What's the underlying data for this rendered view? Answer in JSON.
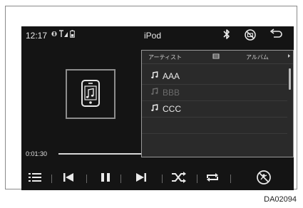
{
  "status_bar": {
    "time": "12:17",
    "title": "iPod",
    "icons": [
      "bluetooth-phone-icon",
      "signal-icon",
      "battery-icon",
      "bluetooth-icon",
      "no-media-icon",
      "back-icon"
    ]
  },
  "artwork": {
    "icon": "phone-music-icon"
  },
  "browse_popup": {
    "tabs": [
      "アーティスト",
      "アルバム"
    ],
    "tab_icons": [
      "list-icon",
      "chevron-right-icon"
    ],
    "items": [
      {
        "label": "AAA",
        "enabled": true
      },
      {
        "label": "BBB",
        "enabled": false
      },
      {
        "label": "CCC",
        "enabled": true
      }
    ],
    "item_icon": "music-note-icon"
  },
  "playback": {
    "elapsed": "0:01:30",
    "progress": 0.38
  },
  "controls": [
    "menu-icon",
    "previous-track-icon",
    "pause-icon",
    "next-track-icon",
    "shuffle-icon",
    "repeat-icon",
    "no-voice-icon"
  ],
  "figure_code": "DA02094",
  "colors": {
    "screen_bg": "#141414",
    "popup_bg": "#2a2a2a",
    "foreground": "#eaeaea",
    "disabled": "#6b6b6b"
  }
}
